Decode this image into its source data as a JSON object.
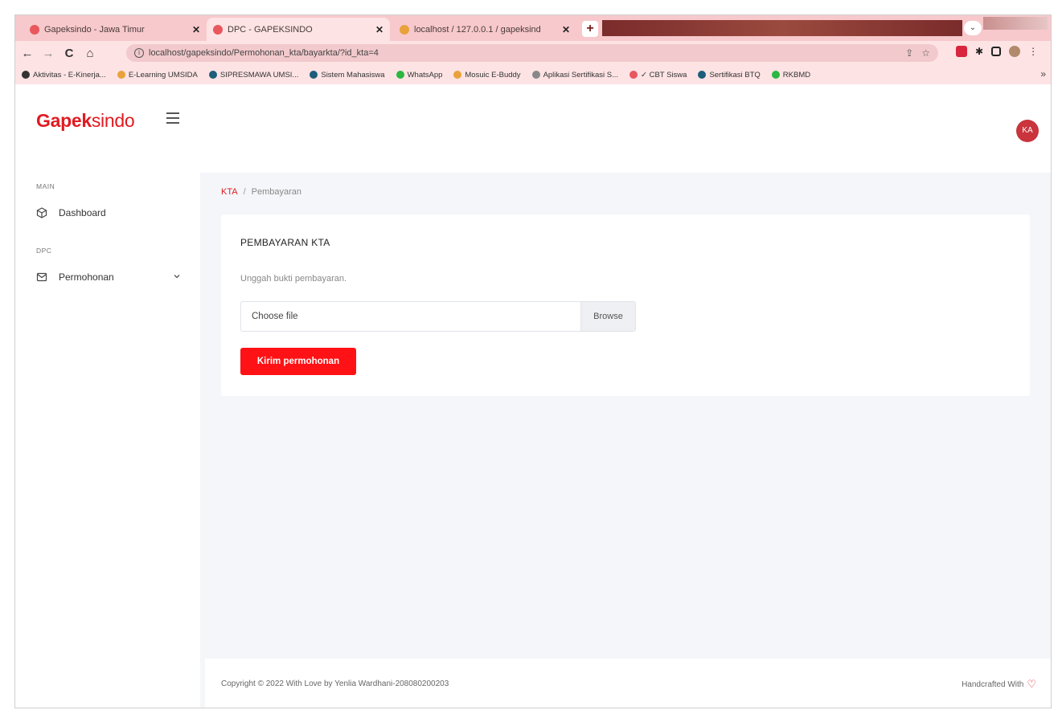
{
  "browser": {
    "tabs": [
      {
        "title": "Gapeksindo - Jawa Timur",
        "favicon_color": "#e8585d"
      },
      {
        "title": "DPC - GAPEKSINDO",
        "favicon_color": "#e8585d"
      },
      {
        "title": "localhost / 127.0.0.1 / gapeksind",
        "favicon_color": "#e9a23b"
      }
    ],
    "new_tab": "+",
    "url": "localhost/gapeksindo/Permohonan_kta/bayarkta/?id_kta=4",
    "bookmarks": [
      {
        "label": "Aktivitas - E-Kinerja...",
        "color": "#333333"
      },
      {
        "label": "E-Learning UMSIDA",
        "color": "#e9a23b"
      },
      {
        "label": "SIPRESMAWA UMSI...",
        "color": "#1d5e7a"
      },
      {
        "label": "Sistem Mahasiswa",
        "color": "#1d5e7a"
      },
      {
        "label": "WhatsApp",
        "color": "#2bb741"
      },
      {
        "label": "Mosuic E-Buddy",
        "color": "#e9a23b"
      },
      {
        "label": "Aplikasi Sertifikasi S...",
        "color": "#888888"
      },
      {
        "label": "✓ CBT Siswa",
        "color": "#e8585d"
      },
      {
        "label": "Sertifikasi BTQ",
        "color": "#1d5e7a"
      },
      {
        "label": "RKBMD",
        "color": "#2bb741"
      }
    ],
    "more_bookmarks": "»"
  },
  "header": {
    "brand_bold": "Gapek",
    "brand_rest": "sindo",
    "avatar_initials": "KA",
    "brand_color": "#e01b22"
  },
  "sidebar": {
    "sections": [
      {
        "heading": "MAIN",
        "items": [
          {
            "label": "Dashboard",
            "icon": "cube-icon"
          }
        ]
      },
      {
        "heading": "DPC",
        "items": [
          {
            "label": "Permohonan",
            "icon": "envelope-icon",
            "has_submenu": true
          }
        ]
      }
    ]
  },
  "breadcrumb": {
    "link": "KTA",
    "separator": "/",
    "current": "Pembayaran"
  },
  "card": {
    "title": "PEMBAYARAN KTA",
    "subtitle": "Unggah bukti pembayaran.",
    "file_input": {
      "label": "Choose file",
      "browse": "Browse"
    },
    "submit_label": "Kirim permohonan",
    "submit_color": "#ff1215"
  },
  "footer": {
    "copyright": "Copyright © 2022 With Love by Yenlia Wardhani-208080200203",
    "handcrafted": "Handcrafted With"
  }
}
